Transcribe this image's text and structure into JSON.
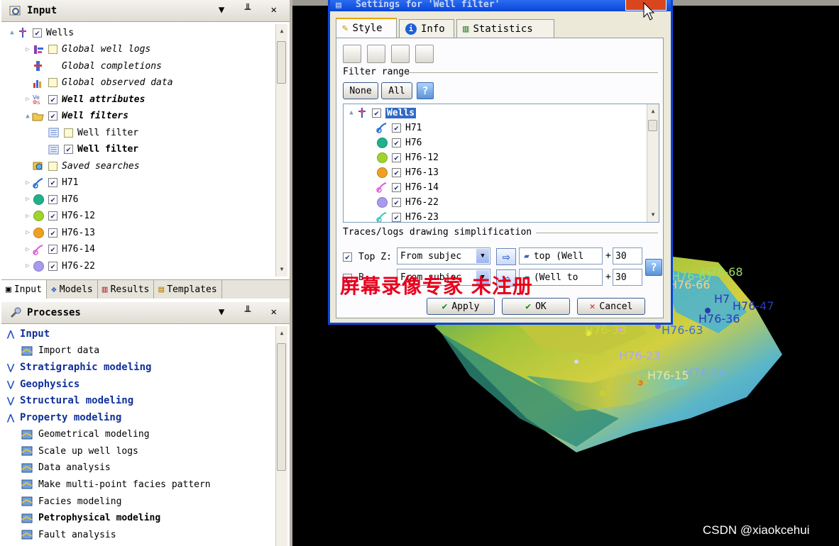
{
  "input_panel": {
    "title": "Input",
    "tree": [
      {
        "label": "Wells",
        "style": "normal",
        "check": "checked",
        "icon": "wells-folder-icon",
        "indent": 0,
        "tri": "▲"
      },
      {
        "label": "Global well logs",
        "style": "italic",
        "check": "empty",
        "icon": "well-logs-icon",
        "indent": 1,
        "tri": "▷"
      },
      {
        "label": "Global completions",
        "style": "italic",
        "check": "none",
        "icon": "completions-icon",
        "indent": 1,
        "tri": ""
      },
      {
        "label": "Global observed data",
        "style": "italic",
        "check": "empty",
        "icon": "bar-chart-icon",
        "indent": 1,
        "tri": ""
      },
      {
        "label": "Well attributes",
        "style": "bolditalic",
        "check": "checked",
        "icon": "attributes-icon",
        "indent": 1,
        "tri": "▷"
      },
      {
        "label": "Well filters",
        "style": "bolditalic",
        "check": "checked",
        "icon": "folder-open-icon",
        "indent": 1,
        "tri": "▲"
      },
      {
        "label": "Well filter",
        "style": "normal",
        "check": "empty",
        "icon": "filter-icon",
        "indent": 2,
        "tri": ""
      },
      {
        "label": "Well filter",
        "style": "bold",
        "check": "checked",
        "icon": "filter-icon",
        "indent": 2,
        "tri": ""
      },
      {
        "label": "Saved searches",
        "style": "italic",
        "check": "empty",
        "icon": "saved-search-icon",
        "indent": 1,
        "tri": ""
      },
      {
        "label": "H71",
        "style": "normal",
        "check": "checked",
        "icon": "deviated-well-blue",
        "indent": 1,
        "tri": "▷"
      },
      {
        "label": "H76",
        "style": "normal",
        "check": "checked",
        "icon": "dot-teal",
        "indent": 1,
        "tri": "▷"
      },
      {
        "label": "H76-12",
        "style": "normal",
        "check": "checked",
        "icon": "dot-lime",
        "indent": 1,
        "tri": "▷"
      },
      {
        "label": "H76-13",
        "style": "normal",
        "check": "checked",
        "icon": "dot-orange",
        "indent": 1,
        "tri": "▷"
      },
      {
        "label": "H76-14",
        "style": "normal",
        "check": "checked",
        "icon": "deviated-well-pink",
        "indent": 1,
        "tri": "▷"
      },
      {
        "label": "H76-22",
        "style": "normal",
        "check": "checked",
        "icon": "dot-lavender",
        "indent": 1,
        "tri": "▷"
      }
    ],
    "tabs": [
      "Input",
      "Models",
      "Results",
      "Templates"
    ]
  },
  "processes_panel": {
    "title": "Processes",
    "items": [
      {
        "label": "Input",
        "type": "category",
        "open": true
      },
      {
        "label": "Import data",
        "type": "item",
        "icon": "import-folder-icon"
      },
      {
        "label": "Stratigraphic modeling",
        "type": "category",
        "open": false
      },
      {
        "label": "Geophysics",
        "type": "category",
        "open": false
      },
      {
        "label": "Structural modeling",
        "type": "category",
        "open": false
      },
      {
        "label": "Property modeling",
        "type": "category",
        "open": true
      },
      {
        "label": "Geometrical modeling",
        "type": "item",
        "icon": "geometrical-icon"
      },
      {
        "label": "Scale up well logs",
        "type": "item",
        "icon": "scale-up-icon"
      },
      {
        "label": "Data analysis",
        "type": "item",
        "icon": "data-analysis-icon"
      },
      {
        "label": "Make multi-point facies pattern",
        "type": "item",
        "icon": "facies-pattern-icon"
      },
      {
        "label": "Facies modeling",
        "type": "item",
        "icon": "facies-icon"
      },
      {
        "label": "Petrophysical modeling",
        "type": "item",
        "icon": "petrophysical-icon",
        "bold": true
      },
      {
        "label": "Fault analysis",
        "type": "item",
        "icon": "fault-icon"
      }
    ]
  },
  "dialog": {
    "title": "Settings for 'Well filter'",
    "tabs": [
      "Style",
      "Info",
      "Statistics"
    ],
    "filter_range_label": "Filter range",
    "none_label": "None",
    "all_label": "All",
    "help_glyph": "?",
    "tree": [
      "Wells",
      "H71",
      "H76",
      "H76-12",
      "H76-13",
      "H76-14",
      "H76-22",
      "H76-23"
    ],
    "traces_label": "Traces/logs drawing simplification",
    "top_z_label": "Top Z:",
    "top_combo": "From subjec",
    "top_target": "top (Well",
    "top_plus": "+",
    "top_value": "30",
    "bottom_prefix": "B",
    "bottom_combo": "From subjec",
    "bottom_target": "(Well to",
    "bottom_plus": "+",
    "bottom_value": "30",
    "watermark": "屏幕录像专家 未注册",
    "apply_label": "Apply",
    "ok_label": "OK",
    "cancel_label": "Cancel"
  },
  "viewport_labels": [
    "H76-68",
    "H7",
    "H76-47",
    "H76-36",
    "H76-33",
    "H76-63",
    "H76-23",
    "H76-14",
    "H76-12",
    "H76-15",
    "H76-66",
    "H76-67"
  ],
  "credit": "CSDN @xiaokcehui"
}
